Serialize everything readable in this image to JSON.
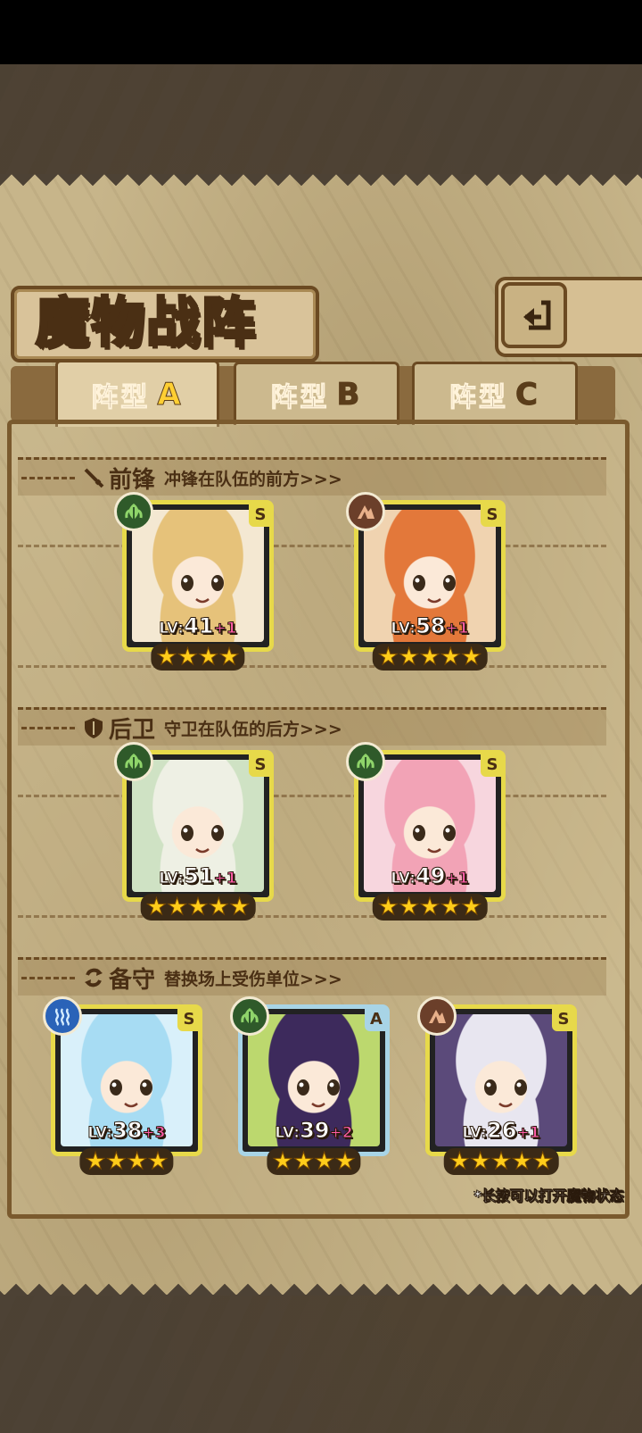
{
  "title": "魔物战阵",
  "tabs": [
    {
      "label": "阵型",
      "letter": "A",
      "active": true
    },
    {
      "label": "阵型",
      "letter": "B",
      "active": false
    },
    {
      "label": "阵型",
      "letter": "C",
      "active": false
    }
  ],
  "sections": {
    "front": {
      "title": "前锋",
      "desc": "冲锋在队伍的前方>>>"
    },
    "back": {
      "title": "后卫",
      "desc": "守卫在队伍的后方>>>"
    },
    "reserve": {
      "title": "备守",
      "desc": "替换场上受伤单位>>>"
    }
  },
  "cards": [
    {
      "element": "leaf-icon",
      "rank": "S",
      "lv_prefix": "LV:",
      "level": "41",
      "plus": "+1",
      "stars": 4,
      "hair": "#e6c27a",
      "bg": "#f4e8d2"
    },
    {
      "element": "earth-icon",
      "rank": "S",
      "lv_prefix": "LV:",
      "level": "58",
      "plus": "+1",
      "stars": 5,
      "hair": "#e3783a",
      "bg": "#f0d3b0"
    },
    {
      "element": "leaf-icon",
      "rank": "S",
      "lv_prefix": "LV:",
      "level": "51",
      "plus": "+1",
      "stars": 5,
      "hair": "#eef0e4",
      "bg": "#cfe2c4"
    },
    {
      "element": "leaf-icon",
      "rank": "S",
      "lv_prefix": "LV:",
      "level": "49",
      "plus": "+1",
      "stars": 5,
      "hair": "#f2a3b6",
      "bg": "#f7d6de"
    },
    {
      "element": "water-icon",
      "rank": "S",
      "lv_prefix": "LV:",
      "level": "38",
      "plus": "+3",
      "stars": 4,
      "hair": "#a7dcf3",
      "bg": "#d9f0fa"
    },
    {
      "element": "leaf-icon",
      "rank": "A",
      "lv_prefix": "LV:",
      "level": "39",
      "plus": "+2",
      "stars": 4,
      "hair": "#3d2a5c",
      "bg": "#bcd86e"
    },
    {
      "element": "earth-icon",
      "rank": "S",
      "lv_prefix": "LV:",
      "level": "26",
      "plus": "+1",
      "stars": 5,
      "hair": "#e8e6f0",
      "bg": "#5b4a7a"
    }
  ],
  "hint": "*长按可以打开魔物状态",
  "star_glyph": "★"
}
